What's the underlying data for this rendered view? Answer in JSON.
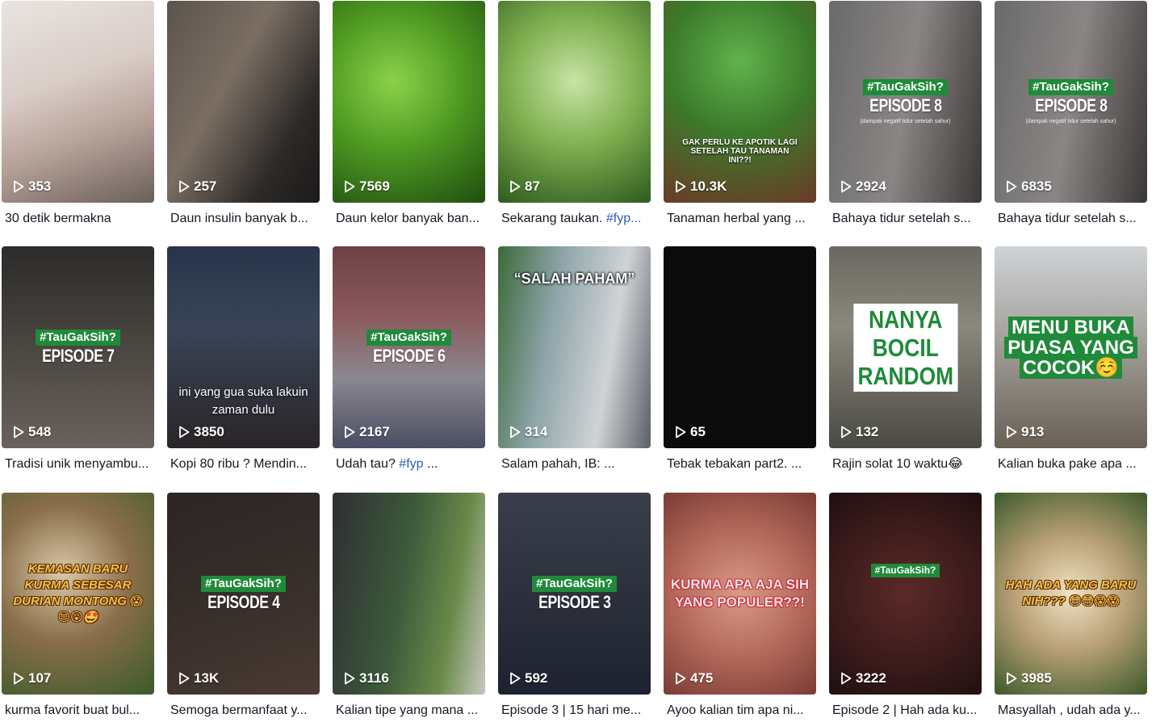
{
  "videos": [
    {
      "views": "353",
      "title": "30 detik bermakna",
      "bg": "linear-gradient(160deg,#e9e4e0 0%,#d9ccc6 40%,#b8a39a 65%,#6b5f5a 100%)"
    },
    {
      "views": "257",
      "title": "Daun insulin banyak b...",
      "bg": "linear-gradient(120deg,#5c544d 0%,#7b6e63 40%,#2d2a28 75%,#1b1a19 100%)"
    },
    {
      "views": "7569",
      "title": "Daun kelor banyak ban...",
      "bg": "radial-gradient(circle at 40% 40%,#8bd24a 0%,#4f9a22 45%,#1f4d10 100%)"
    },
    {
      "views": "87",
      "title": "Sekarang taukan.",
      "tag": "#fyp...",
      "bg": "radial-gradient(circle at 50% 40%,#c8e3a6 0%,#7fb04f 45%,#2f5a20 100%)"
    },
    {
      "views": "10.3K",
      "title": "Tanaman herbal yang ...",
      "overlay": "GAK PERLU KE APOTIK LAGI SETELAH TAU TANAMAN INI??!",
      "bg": "radial-gradient(circle at 50% 30%,#5fb34c 0%,#3c7a2a 45%,#6b3a28 100%)"
    },
    {
      "views": "2924",
      "title": "Bahaya tidur setelah s...",
      "badge": "#TauGakSih?",
      "episode": "EPISODE 8",
      "sub": "(dampak negatif tidur setelah sahur)",
      "bg": "linear-gradient(100deg,#6a6a6a 0%,#8a8585 50%,#3c3737 100%)"
    },
    {
      "views": "6835",
      "title": "Bahaya tidur setelah s...",
      "badge": "#TauGakSih?",
      "episode": "EPISODE 8",
      "sub": "(dampak negatif tidur setelah sahur)",
      "bg": "linear-gradient(100deg,#6a6a6a 0%,#8a8585 50%,#3c3737 100%)"
    },
    {
      "views": "548",
      "title": "Tradisi unik menyambu...",
      "badge": "#TauGakSih?",
      "episode": "EPISODE 7",
      "bg": "linear-gradient(180deg,#2c2b2a 0%,#4a4640 50%,#6a625c 100%)"
    },
    {
      "views": "3850",
      "title": "Kopi 80 ribu ? Mendin...",
      "caption": "ini yang gua suka lakuin zaman dulu",
      "bg": "linear-gradient(180deg,#28344a 0%,#394457 40%,#2a2528 100%)"
    },
    {
      "views": "2167",
      "title": "Udah tau?",
      "tag": "#fyp",
      "tagTail": " ...",
      "badge": "#TauGakSih?",
      "episode": "EPISODE 6",
      "bg": "linear-gradient(180deg,#6d4246 0%,#8a5a5c 35%,#8b8790 65%,#4a4e63 100%)"
    },
    {
      "views": "314",
      "title": "Salam pahah, IB: ...",
      "salah": "“SALAH PAHAM”",
      "bg": "linear-gradient(100deg,#3c6a3a 0%,#8da4a8 35%,#d0d3d6 70%,#5a5f66 100%)"
    },
    {
      "views": "65",
      "title": "Tebak tebakan part2. ...",
      "bg": "#0b0b0c"
    },
    {
      "views": "132",
      "title": "Rajin solat 10 waktu😂",
      "bigbox": [
        "NANYA",
        "BOCIL",
        "RANDOM"
      ],
      "bg": "linear-gradient(180deg,#6a6860 0%,#8b877d 40%,#4a4a42 100%)"
    },
    {
      "views": "913",
      "title": "Kalian buka pake apa ...",
      "greenblock": [
        "MENU BUKA",
        "PUASA YANG",
        "COCOK☺️"
      ],
      "bg": "linear-gradient(180deg,#cfd3d6 0%,#a4a29c 45%,#6a6056 100%)"
    },
    {
      "views": "107",
      "title": "kurma favorit buat bul...",
      "yellow": "KEMASAN BARU KURMA SEBESAR DURIAN MONTONG 😱😊😮🤩",
      "bg": "radial-gradient(circle at 40% 40%,#d9c8a8 0%,#8a6e4a 45%,#3a5a2a 100%)"
    },
    {
      "views": "13K",
      "title": "Semoga bermanfaat y...",
      "badge": "#TauGakSih?",
      "episode": "EPISODE 4",
      "bg": "linear-gradient(160deg,#2b2524 0%,#3a302c 60%,#4a3a32 100%)"
    },
    {
      "views": "3116",
      "title": "Kalian tipe yang mana ...",
      "bg": "linear-gradient(100deg,#2e2f33 0%,#3d5a3b 45%,#6a8a4a 75%,#c7c7c0 100%)"
    },
    {
      "views": "592",
      "title": "Episode 3 | 15 hari me...",
      "badge": "#TauGakSih?",
      "episode": "EPISODE 3",
      "bg": "linear-gradient(180deg,#3a3e4a 0%,#2a2e3a 60%,#1e2230 100%)"
    },
    {
      "views": "475",
      "title": "Ayoo kalian tim apa ni...",
      "pink": "KURMA APA AJA SIH YANG POPULER??!",
      "bg": "radial-gradient(circle at 50% 50%,#d99a86 0%,#b4695a 50%,#7a3c34 100%)"
    },
    {
      "views": "3222",
      "title": "Episode 2 | Hah ada ku...",
      "badgeSmall": "#TauGakSih?",
      "bg": "radial-gradient(circle at 50% 50%,#5a2a28 0%,#3a1a1a 60%,#1e1010 100%)"
    },
    {
      "views": "3985",
      "title": "Masyallah , udah ada y...",
      "yellow": "HAH ADA YANG BARU NIH??? 😳😳😱😱",
      "bg": "radial-gradient(circle at 50% 50%,#efe3c4 0%,#b9a076 45%,#3c5a2a 100%)"
    }
  ]
}
